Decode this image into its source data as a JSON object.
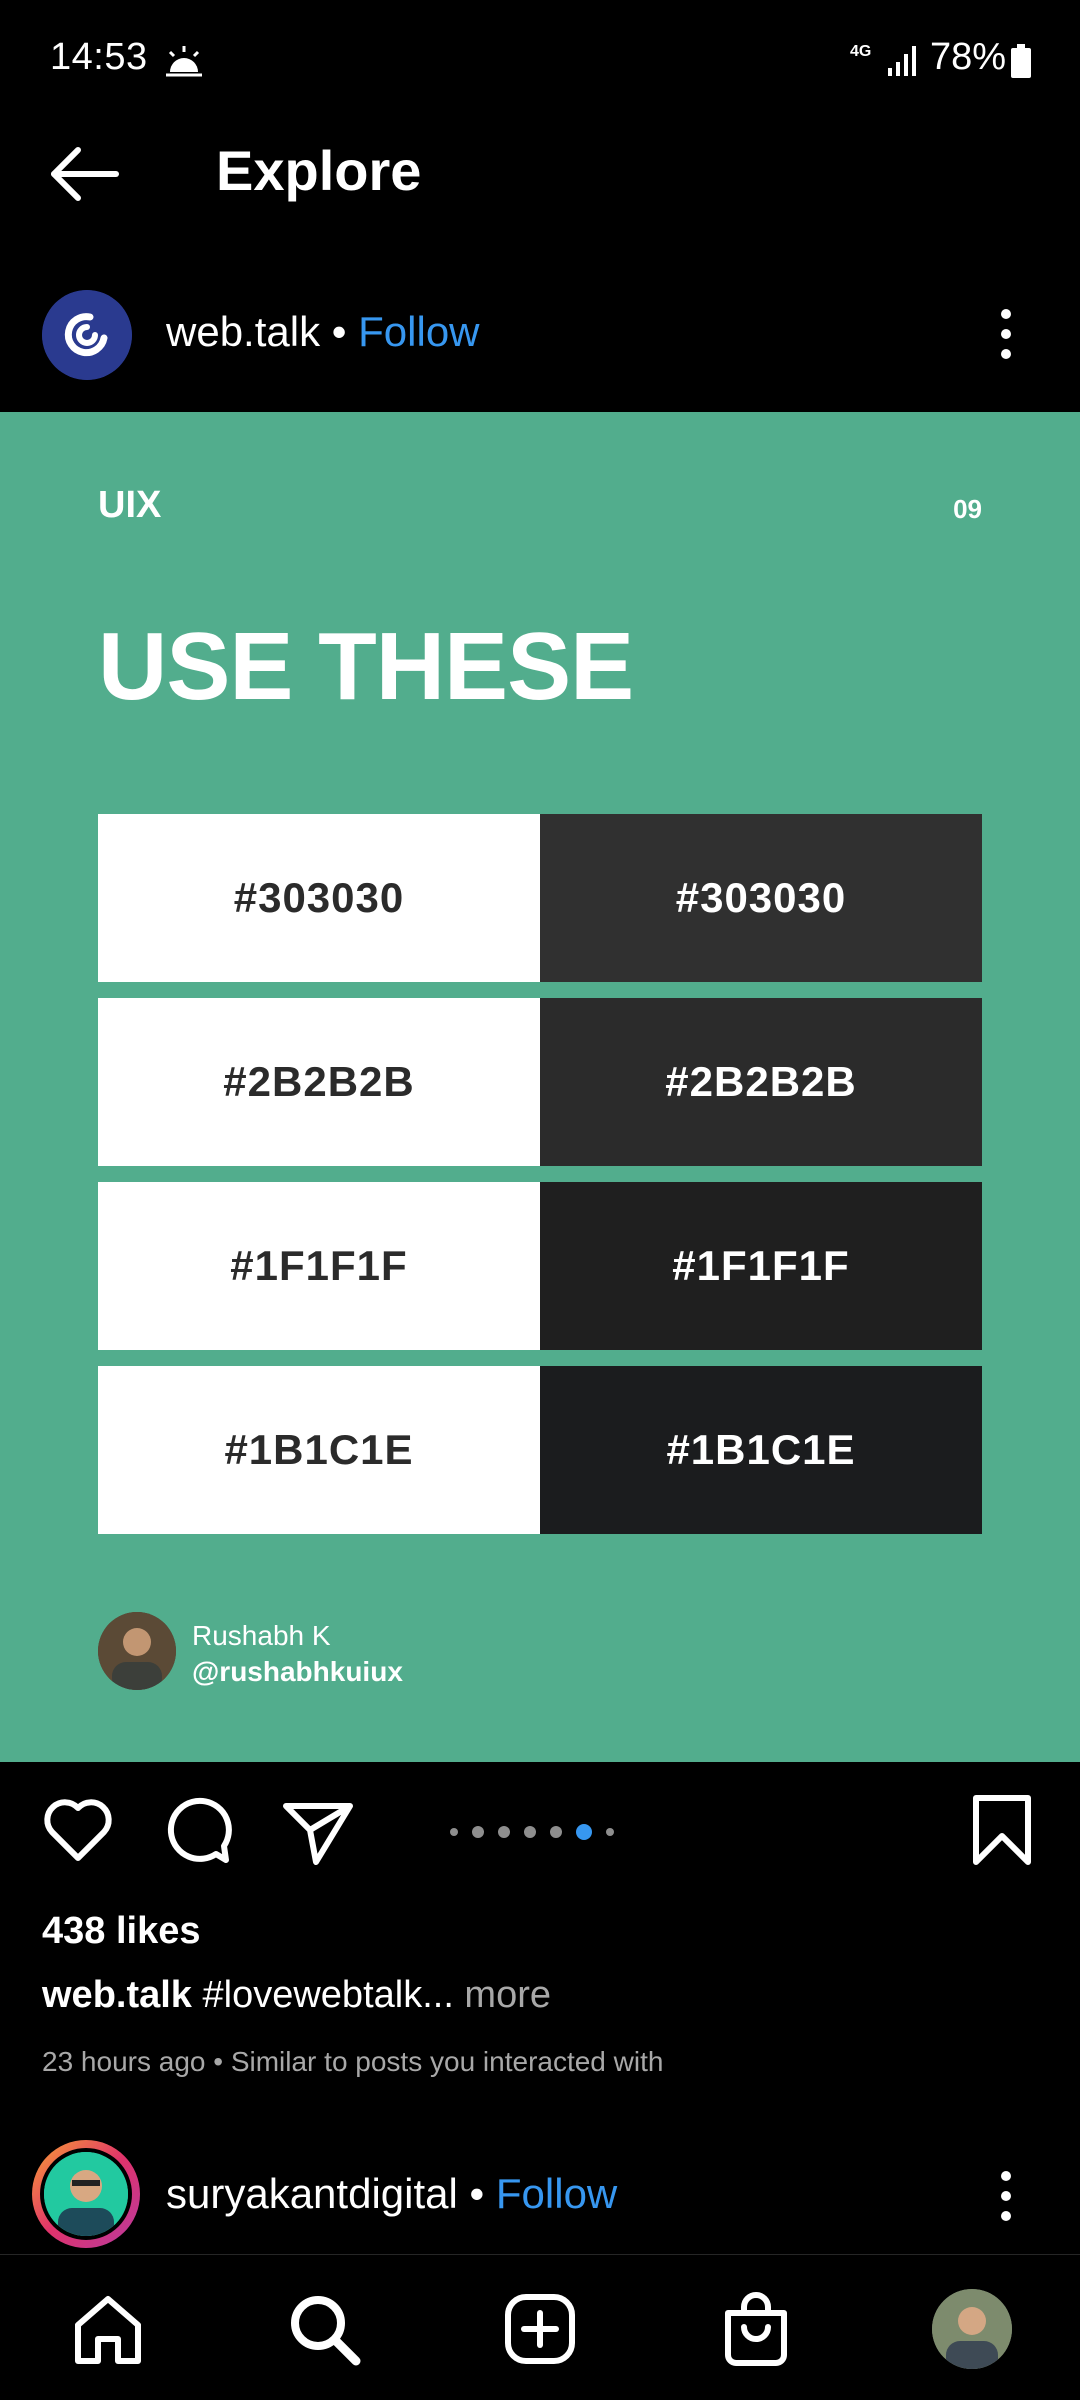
{
  "status_bar": {
    "time": "14:53",
    "network": "4G",
    "battery": "78%",
    "icons": [
      "weather-icon",
      "signal-icon",
      "battery-icon"
    ]
  },
  "header": {
    "title": "Explore",
    "back_icon": "back-arrow-icon"
  },
  "post": {
    "username": "web.talk",
    "separator": "•",
    "follow_label": "Follow",
    "image": {
      "background": "#52ad8d",
      "label": "UIX",
      "page_number": "09",
      "title": "USE THESE",
      "swatches": [
        {
          "light_label": "#303030",
          "dark_label": "#303030",
          "dark_color": "#303030"
        },
        {
          "light_label": "#2B2B2B",
          "dark_label": "#2B2B2B",
          "dark_color": "#2b2b2b"
        },
        {
          "light_label": "#1F1F1F",
          "dark_label": "#1F1F1F",
          "dark_color": "#1f1f1f"
        },
        {
          "light_label": "#1B1C1E",
          "dark_label": "#1B1C1E",
          "dark_color": "#1b1c1e"
        }
      ],
      "author_name": "Rushabh K",
      "author_handle": "@rushabhkuiux"
    },
    "carousel": {
      "count": 7,
      "active_index": 5
    },
    "likes": "438 likes",
    "caption_user": "web.talk",
    "caption_text": " #lovewebtalk...",
    "caption_more": " more",
    "time_line": "23 hours ago • Similar to posts you interacted with"
  },
  "next_post": {
    "username": "suryakantdigital",
    "separator": "•",
    "follow_label": "Follow"
  },
  "bottom_nav": {
    "items": [
      "home-icon",
      "search-icon",
      "create-icon",
      "shop-icon",
      "profile-avatar"
    ]
  },
  "colors": {
    "accent": "#3797f0",
    "post_bg": "#52ad8d",
    "background": "#000000"
  }
}
